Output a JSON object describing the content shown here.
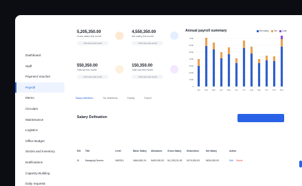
{
  "nav": [
    "Dashboard",
    "Staff",
    "Payment Voucher",
    "Payroll",
    "Memo",
    "Circulars",
    "Maintenance",
    "Logistics",
    "Office Budget",
    "Stocks and Inventory",
    "Notifications",
    "Capacity Building",
    "Daily requests"
  ],
  "nav_active": "Payroll",
  "cards": [
    {
      "value": "5,205,350.00",
      "label": "Gross salary this month",
      "note": "13% since last month",
      "color": "#fde9d2"
    },
    {
      "value": "4,550,350.00",
      "label": "Net salary this month",
      "note": "2.5% since last month",
      "color": "#e3efff"
    },
    {
      "value": "550,350.00",
      "label": "Total tax this month",
      "note": "2.4% since last month",
      "color": "#fdf0dc"
    },
    {
      "value": "150,350.00",
      "label": "Total loan this month",
      "note": "1.9% since last month",
      "color": "#f3e8ff"
    }
  ],
  "chart_data": {
    "type": "bar",
    "title": "Annual payroll summary",
    "categories": [
      "Jan",
      "Feb",
      "Mar",
      "Apr",
      "May",
      "Jun",
      "Jul",
      "Aug",
      "Sep",
      "Oct",
      "Nov",
      "Dec"
    ],
    "series": [
      {
        "name": "Net salary",
        "color": "#2f5fc9",
        "values": [
          300,
          590,
          540,
          410,
          470,
          340,
          560,
          480,
          340,
          380,
          370,
          580
        ]
      },
      {
        "name": "Tax",
        "color": "#e8a356",
        "values": [
          100,
          120,
          100,
          90,
          100,
          70,
          110,
          100,
          60,
          70,
          70,
          110
        ]
      },
      {
        "name": "Loan",
        "color": "#8a4fd8",
        "values": [
          0,
          0,
          0,
          0,
          0,
          0,
          0,
          0,
          0,
          0,
          0,
          120
        ]
      }
    ],
    "yticks": [
      "0",
      "100k",
      "200k",
      "300k",
      "400k",
      "500k",
      "600k",
      "700k"
    ],
    "ylim": [
      0,
      700
    ],
    "stacked": true
  },
  "tabs": [
    "Salary definitions",
    "Tax definitions",
    "Payslip",
    "Payroll"
  ],
  "tab_active": "Salary definitions",
  "section_title": "Salary Defination",
  "table": {
    "headers": [
      "S/N",
      "Title",
      "Level",
      "Basic Salary",
      "Allowance",
      "Gross Salary",
      "Deductions",
      "Net Salary",
      "Action"
    ],
    "rows": [
      [
        "01",
        "Managing Director",
        "HM2011",
        "N464,651.24",
        "N400,000.00",
        "N1,125,211.00",
        "N174,000.00",
        "N034,000.00"
      ]
    ],
    "edit_label": "Edit",
    "delete_label": "Delete"
  }
}
